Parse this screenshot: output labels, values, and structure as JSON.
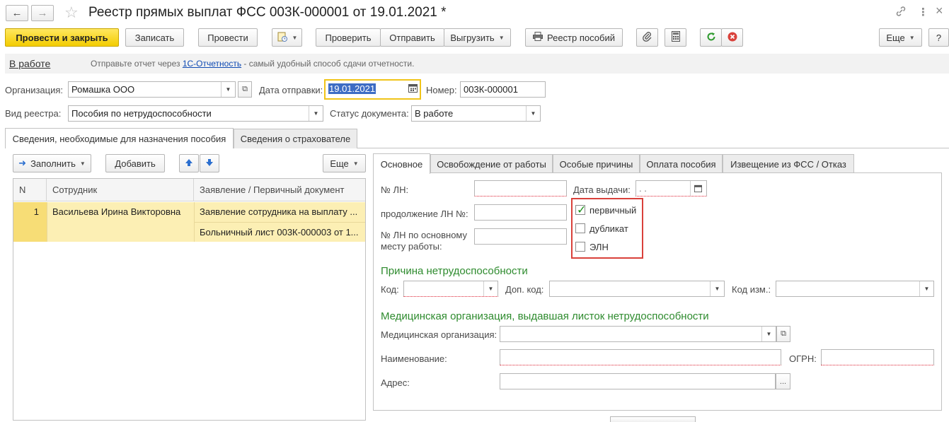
{
  "window": {
    "title": "Реестр прямых выплат ФСС 003К-000001 от 19.01.2021 *",
    "back_icon": "←",
    "forward_icon": "→",
    "star_icon": "☆",
    "link_icon": "🔗",
    "menu_icon": "⋮",
    "close_icon": "×"
  },
  "toolbar": {
    "post_close": "Провести и закрыть",
    "write": "Записать",
    "post": "Провести",
    "check": "Проверить",
    "send": "Отправить",
    "export": "Выгрузить",
    "benefits_register": "Реестр пособий",
    "more": "Еще",
    "help": "?"
  },
  "status_strip": {
    "state": "В работе",
    "hint_before": "Отправьте отчет через ",
    "hint_link": "1С-Отчетность",
    "hint_after": " - самый удобный способ сдачи отчетности."
  },
  "form": {
    "org_label": "Организация:",
    "org_value": "Ромашка ООО",
    "send_date_label": "Дата отправки:",
    "send_date_value": "19.01.2021",
    "number_label": "Номер:",
    "number_value": "003К-000001",
    "register_type_label": "Вид реестра:",
    "register_type_value": "Пособия по нетрудоспособности",
    "doc_status_label": "Статус документа:",
    "doc_status_value": "В работе"
  },
  "main_tabs": [
    "Сведения, необходимые для назначения пособия",
    "Сведения о страхователе"
  ],
  "left_toolbar": {
    "fill": "Заполнить",
    "add": "Добавить",
    "more": "Еще"
  },
  "table": {
    "columns": [
      "N",
      "Сотрудник",
      "Заявление / Первичный документ"
    ],
    "rows": [
      {
        "n": "1",
        "employee": "Васильева Ирина Викторовна",
        "doc1": "Заявление сотрудника на выплату ...",
        "doc2": "Больничный лист 003К-000003 от 1..."
      }
    ]
  },
  "sub_tabs": [
    "Основное",
    "Освобождение от работы",
    "Особые причины",
    "Оплата пособия",
    "Извещение из ФСС / Отказ"
  ],
  "panel": {
    "ln_label": "№ ЛН:",
    "issue_date_label": "Дата выдачи:",
    "issue_date_value": " .  .",
    "continuation_label": "продолжение ЛН №:",
    "main_job_label_1": "№ ЛН по основному",
    "main_job_label_2": "месту работы:",
    "checkboxes": [
      {
        "label": "первичный",
        "checked": true
      },
      {
        "label": "дубликат",
        "checked": false
      },
      {
        "label": "ЭЛН",
        "checked": false
      }
    ],
    "cause_section": "Причина нетрудоспособности",
    "code_label": "Код:",
    "extra_code_label": "Доп. код:",
    "change_code_label": "Код изм.:",
    "med_section": "Медицинская организация, выдавшая листок нетрудоспособности",
    "med_org_label": "Медицинская организация:",
    "name_label": "Наименование:",
    "ogrn_label": "ОГРН:",
    "address_label": "Адрес:",
    "ellipsis": "..."
  },
  "colors": {
    "accent_yellow": "#f3cc00",
    "row_highlight": "#fcefb4",
    "section_green": "#2e8b2e",
    "link_blue": "#0f4ab3",
    "highlight_red": "#d9413b"
  }
}
